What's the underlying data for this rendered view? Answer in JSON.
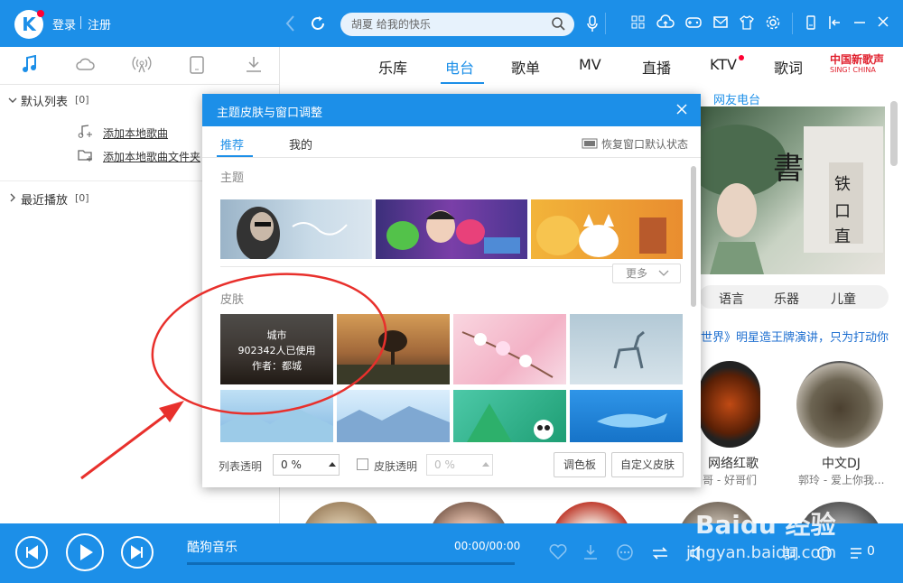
{
  "app": {
    "login": "登录",
    "register": "注册",
    "search_placeholder": "胡夏 给我的快乐"
  },
  "left": {
    "default_list": "默认列表",
    "default_count": "[0]",
    "add_song": "添加本地歌曲",
    "add_folder": "添加本地歌曲文件夹",
    "recent": "最近播放",
    "recent_count": "[0]"
  },
  "nav": {
    "tabs": [
      "乐库",
      "电台",
      "歌单",
      "MV",
      "直播",
      "KTV",
      "歌词"
    ],
    "active": "电台",
    "sing_china": "中国新歌声",
    "sing_china_en": "SING! CHINA",
    "net_radio": "网友电台"
  },
  "content": {
    "categories": [
      "语言",
      "乐器",
      "儿童"
    ],
    "promo": "世界》明星造王牌演讲，只为打动你",
    "radio_items": [
      {
        "title": "网络红歌",
        "sub": "哥 - 好哥们"
      },
      {
        "title": "中文DJ",
        "sub": "郭玲 - 爱上你我..."
      }
    ]
  },
  "dialog": {
    "title": "主题皮肤与窗口调整",
    "tab_recommend": "推荐",
    "tab_mine": "我的",
    "restore": "恢复窗口默认状态",
    "theme_label": "主题",
    "skin_label": "皮肤",
    "more": "更多",
    "city_skin": {
      "name": "城市",
      "users": "902342人已使用",
      "author": "作者：都城"
    },
    "list_transparency_label": "列表透明",
    "list_transparency_value": "0 %",
    "skin_transparency_label": "皮肤透明",
    "skin_transparency_value": "0 %",
    "palette": "调色板",
    "custom_skin": "自定义皮肤"
  },
  "player": {
    "song": "酷狗音乐",
    "time": "00:00/00:00",
    "count": "0"
  },
  "watermark": {
    "line1": "Baidu 经验",
    "line2": "jingyan.baidu.com"
  }
}
